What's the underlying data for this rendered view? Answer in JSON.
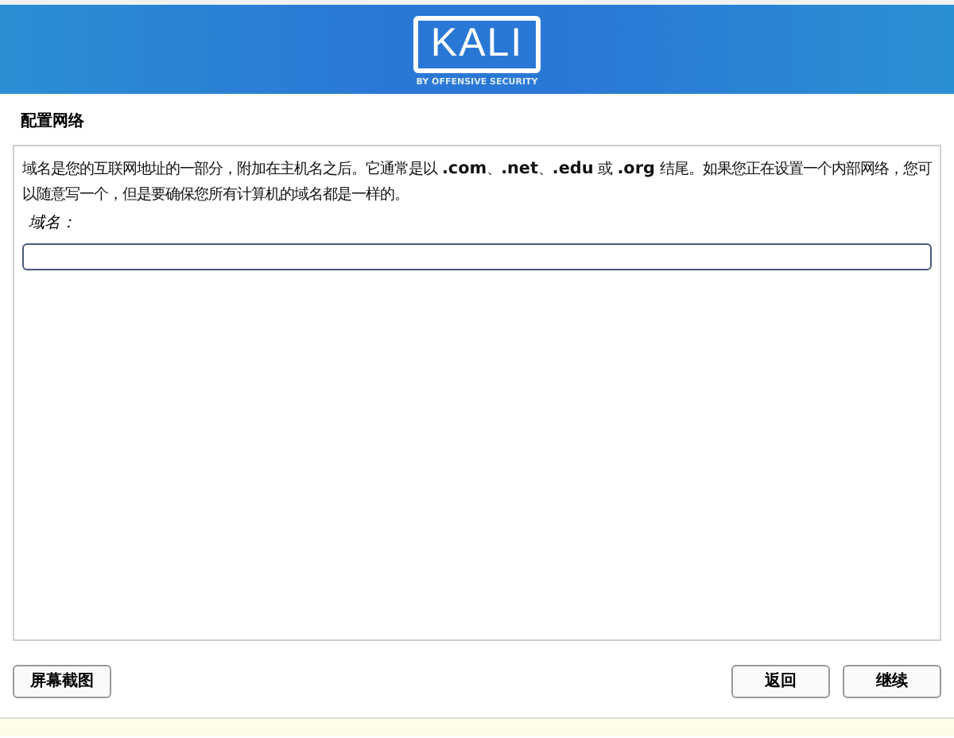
{
  "banner": {
    "logo": "KALI",
    "tagline": "BY OFFENSIVE SECURITY"
  },
  "title": "配置网络",
  "description": "域名是您的互联网地址的一部分，附加在主机名之后。它通常是以 **.com**、**.net**、**.edu** 或 **.org** 结尾。如果您正在设置一个内部网络，您可以随意写一个，但是要确保您所有计算机的域名都是一样的。",
  "field": {
    "label": "域名："
  },
  "buttons": [
    {
      "kind": "left",
      "label": "屏幕截图"
    },
    {
      "kind": "right",
      "label": "返回"
    },
    {
      "kind": "right",
      "label": "继续"
    }
  ]
}
